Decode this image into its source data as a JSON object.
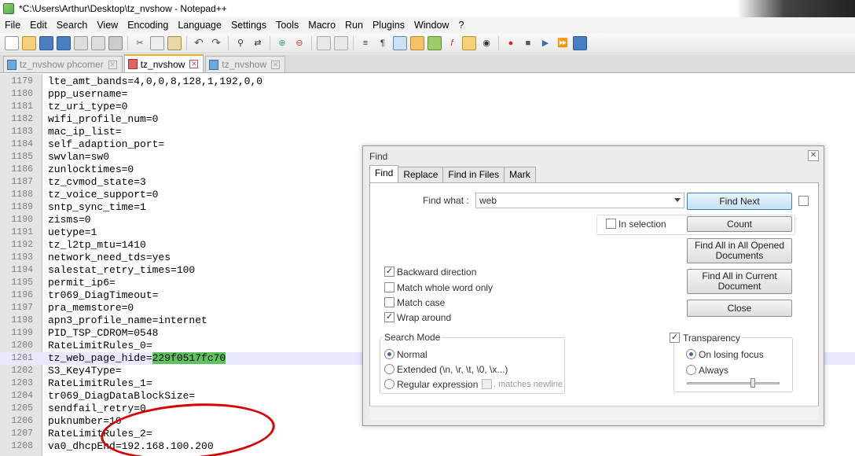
{
  "window": {
    "title": "*C:\\Users\\Arthur\\Desktop\\tz_nvshow - Notepad++"
  },
  "menu": [
    "File",
    "Edit",
    "Search",
    "View",
    "Encoding",
    "Language",
    "Settings",
    "Tools",
    "Macro",
    "Run",
    "Plugins",
    "Window",
    "?"
  ],
  "tabs": [
    {
      "label": "tz_nvshow phcomer",
      "active": false
    },
    {
      "label": "tz_nvshow",
      "active": true
    },
    {
      "label": "tz_nvshow",
      "active": false
    }
  ],
  "editor": {
    "lines": [
      {
        "num": "1179",
        "text": "lte_amt_bands=4,0,0,8,128,1,192,0,0"
      },
      {
        "num": "1180",
        "text": "ppp_username="
      },
      {
        "num": "1181",
        "text": "tz_uri_type=0"
      },
      {
        "num": "1182",
        "text": "wifi_profile_num=0"
      },
      {
        "num": "1183",
        "text": "mac_ip_list="
      },
      {
        "num": "1184",
        "text": "self_adaption_port="
      },
      {
        "num": "1185",
        "text": "swvlan=sw0"
      },
      {
        "num": "1186",
        "text": "zunlocktimes=0"
      },
      {
        "num": "1187",
        "text": "tz_cvmod_state=3"
      },
      {
        "num": "1188",
        "text": "tz_voice_support=0"
      },
      {
        "num": "1189",
        "text": "sntp_sync_time=1"
      },
      {
        "num": "1190",
        "text": "zisms=0"
      },
      {
        "num": "1191",
        "text": "uetype=1"
      },
      {
        "num": "1192",
        "text": "tz_l2tp_mtu=1410"
      },
      {
        "num": "1193",
        "text": "network_need_tds=yes"
      },
      {
        "num": "1194",
        "text": "salestat_retry_times=100"
      },
      {
        "num": "1195",
        "text": "permit_ip6="
      },
      {
        "num": "1196",
        "text": "tr069_DiagTimeout="
      },
      {
        "num": "1197",
        "text": "pra_memstore=0"
      },
      {
        "num": "1198",
        "text": "apn3_profile_name=internet"
      },
      {
        "num": "1199",
        "text": "PID_TSP_CDROM=0548"
      },
      {
        "num": "1200",
        "text": "RateLimitRules_0="
      },
      {
        "num": "1201",
        "text": "tz_web_page_hide=",
        "highlight": "229f0517fc70"
      },
      {
        "num": "1202",
        "text": "S3_Key4Type="
      },
      {
        "num": "1203",
        "text": "RateLimitRules_1="
      },
      {
        "num": "1204",
        "text": "tr069_DiagDataBlockSize="
      },
      {
        "num": "1205",
        "text": "sendfail_retry=0"
      },
      {
        "num": "1206",
        "text": "puknumber=10"
      },
      {
        "num": "1207",
        "text": "RateLimitRules_2="
      },
      {
        "num": "1208",
        "text": "va0_dhcpEnd=192.168.100.200"
      }
    ],
    "current_line": "1201"
  },
  "find_dialog": {
    "title": "Find",
    "tabs": [
      "Find",
      "Replace",
      "Find in Files",
      "Mark"
    ],
    "find_what_label": "Find what :",
    "find_what_value": "web",
    "in_selection_label": "In selection",
    "buttons": {
      "find_next": "Find Next",
      "count": "Count",
      "find_all_opened_line1": "Find All in All Opened",
      "find_all_opened_line2": "Documents",
      "find_all_current_line1": "Find All in Current",
      "find_all_current_line2": "Document",
      "close": "Close"
    },
    "options": {
      "backward_direction": {
        "label": "Backward direction",
        "checked": true
      },
      "match_whole_word": {
        "label": "Match whole word only",
        "checked": false
      },
      "match_case": {
        "label": "Match case",
        "checked": false
      },
      "wrap_around": {
        "label": "Wrap around",
        "checked": true
      }
    },
    "search_mode": {
      "title": "Search Mode",
      "normal": "Normal",
      "extended": "Extended (\\n, \\r, \\t, \\0, \\x...)",
      "regex": "Regular expression",
      "matches_newline": ". matches newline",
      "selected": "normal"
    },
    "transparency": {
      "title": "Transparency",
      "checked": true,
      "on_losing_focus": "On losing focus",
      "always": "Always",
      "selected": "on_losing_focus"
    }
  }
}
